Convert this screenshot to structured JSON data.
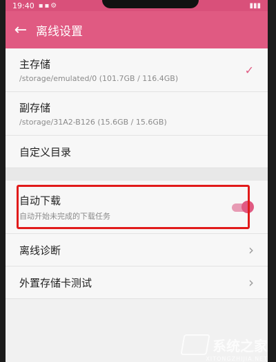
{
  "status_bar": {
    "time": "19:40"
  },
  "app_bar": {
    "title": "离线设置"
  },
  "storage": {
    "primary": {
      "label": "主存储",
      "path": "/storage/emulated/0 (101.7GB / 116.4GB)"
    },
    "secondary": {
      "label": "副存储",
      "path": "/storage/31A2-B126 (15.6GB / 15.6GB)"
    },
    "custom": {
      "label": "自定义目录"
    }
  },
  "auto_download": {
    "label": "自动下载",
    "description": "自动开始未完成的下载任务",
    "enabled": true
  },
  "tools": {
    "diagnose": {
      "label": "离线诊断"
    },
    "sdcard_test": {
      "label": "外置存储卡测试"
    }
  },
  "watermark": {
    "text": "系统之家",
    "url": "XITONGZHIJIA.NET"
  },
  "colors": {
    "accent": "#e05a82",
    "highlight": "#e11a1a"
  }
}
